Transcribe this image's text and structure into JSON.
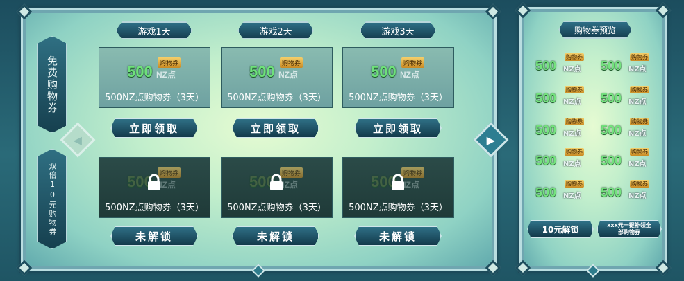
{
  "left_tabs": {
    "free": "免费购物券",
    "double": "双倍10元购物券"
  },
  "days": [
    "游戏1天",
    "游戏2天",
    "游戏3天"
  ],
  "coupon": {
    "value": "500",
    "unit": "NZ点",
    "badge": "购物券",
    "label": "500NZ点购物券（3天）"
  },
  "buttons": {
    "claim": "立即领取",
    "unlock_locked": "未解锁"
  },
  "side": {
    "title": "购物券预览",
    "unlock_10": "10元解锁",
    "unlock_all": "xxx元一键补领全部购物券"
  },
  "colors": {
    "accent": "#2f7086",
    "coupon_green": "#6ee07a",
    "badge_gold": "#f4cf6a"
  }
}
